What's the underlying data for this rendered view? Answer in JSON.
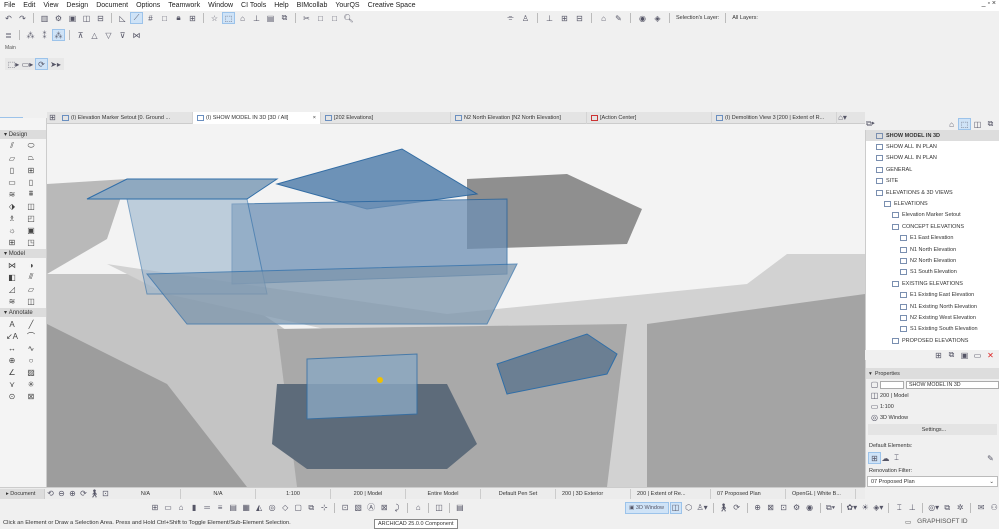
{
  "menu": [
    "File",
    "Edit",
    "View",
    "Design",
    "Document",
    "Options",
    "Teamwork",
    "Window",
    "CI Tools",
    "Help",
    "BIMcollab",
    "YourQS",
    "Creative Space"
  ],
  "window_controls": "_ ▫ ×",
  "toolbar": {
    "selection_layer": "Selection's Layer:",
    "all_layers": "All Layers:",
    "main_label": "Main"
  },
  "tabs": [
    {
      "label": "(I) Elevation Marker Setout [0. Ground ..."
    },
    {
      "label": "(I) SHOW MODEL IN 3D [3D / All]",
      "active": true
    },
    {
      "label": "[202 Elevations]"
    },
    {
      "label": "N2 North Elevation [N2 North Elevation]"
    },
    {
      "label": "[Action Center]"
    },
    {
      "label": "(I) Demolition View 3 [200 | Extent of R..."
    }
  ],
  "toolbox": {
    "sections": [
      "Design",
      "Model",
      "Annotate",
      "Document"
    ]
  },
  "navigator": {
    "items": [
      {
        "label": "SHOW MODEL IN 3D",
        "indent": 0
      },
      {
        "label": "SHOW ALL IN PLAN",
        "indent": 0
      },
      {
        "label": "SHOW ALL IN PLAN",
        "indent": 0
      },
      {
        "label": "GENERAL",
        "indent": 0
      },
      {
        "label": "SITE",
        "indent": 0
      },
      {
        "label": "ELEVATIONS & 3D VIEWS",
        "indent": 0
      },
      {
        "label": "ELEVATIONS",
        "indent": 1
      },
      {
        "label": "Elevation Marker Setout",
        "indent": 2
      },
      {
        "label": "CONCEPT ELEVATIONS",
        "indent": 2
      },
      {
        "label": "E1 East Elevation",
        "indent": 3
      },
      {
        "label": "N1 North Elevation",
        "indent": 3
      },
      {
        "label": "N2 North Elevation",
        "indent": 3
      },
      {
        "label": "S1 South Elevation",
        "indent": 3
      },
      {
        "label": "EXISTING ELEVATIONS",
        "indent": 2
      },
      {
        "label": "E1 Existing East Elevation",
        "indent": 3
      },
      {
        "label": "N1 Existing North Elevation",
        "indent": 3
      },
      {
        "label": "N2 Existing West Elevation",
        "indent": 3
      },
      {
        "label": "S1 Existing South Elevation",
        "indent": 3
      },
      {
        "label": "PROPOSED ELEVATIONS",
        "indent": 2
      }
    ]
  },
  "properties": {
    "title": "Properties",
    "name": "SHOW MODEL IN 3D",
    "layer": "200 | Model",
    "scale": "1:100",
    "view": "3D Window",
    "settings": "Settings...",
    "default_elements": "Default Elements:",
    "renovation_label": "Renovation Filter:",
    "renovation_value": "07 Proposed Plan"
  },
  "bottombar": {
    "document": "Document",
    "na1": "N/A",
    "na2": "N/A",
    "scale": "1:100",
    "layer_combo": "200 | Model",
    "model": "Entire Model",
    "pen_set": "Default Pen Set",
    "view3d": "200 | 3D Exterior",
    "graphic": "200 | Extent of Re...",
    "renovation": "07 Proposed Plan",
    "engine": "OpenGL | White B..."
  },
  "toolbar2": {
    "window_3d": "3D Window"
  },
  "status": "Click an Element or Draw a Selection Area. Press and Hold Ctrl+Shift to Toggle Element/Sub-Element Selection.",
  "tooltip": "ARCHICAD 25.0.0 Component",
  "brand": "GRAPHISOFT ID"
}
